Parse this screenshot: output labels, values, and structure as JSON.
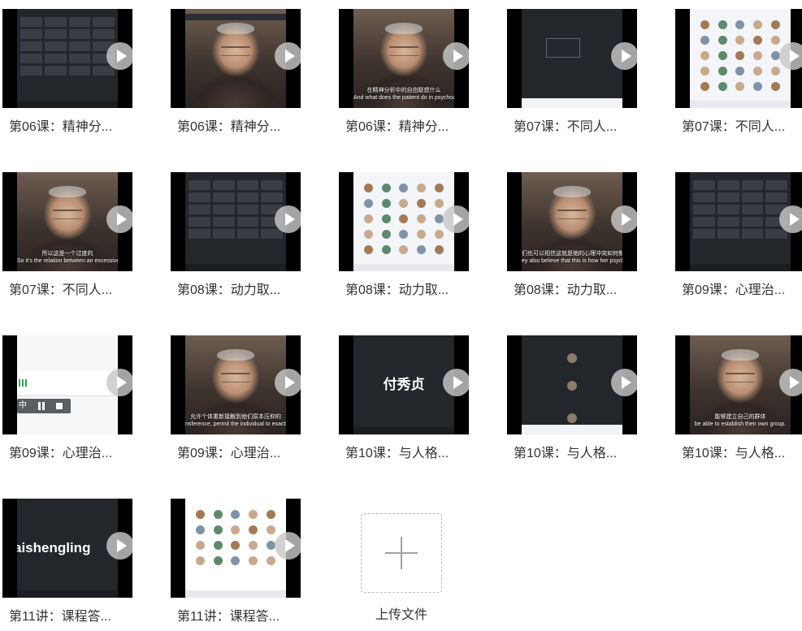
{
  "videos": [
    {
      "id": "v1",
      "caption": "第06课：精神分...",
      "style": "dark-tiles"
    },
    {
      "id": "v2",
      "caption": "第06课：精神分...",
      "style": "person-zoom"
    },
    {
      "id": "v3",
      "caption": "第06课：精神分...",
      "style": "person",
      "subtitle_cn": "在精神分析中的自由联想什么",
      "subtitle_en": "And what does the patient do in psychoanalysis"
    },
    {
      "id": "v4",
      "caption": "第07课：不同人...",
      "style": "dark-empty"
    },
    {
      "id": "v5",
      "caption": "第07课：不同人...",
      "style": "avatars"
    },
    {
      "id": "v6",
      "caption": "第07课：不同人...",
      "style": "person",
      "subtitle_cn": "所以这是一个过度的",
      "subtitle_en": "So it's the relation between an excessive,"
    },
    {
      "id": "v7",
      "caption": "第08课：动力取...",
      "style": "dark-tiles"
    },
    {
      "id": "v8",
      "caption": "第08课：动力取...",
      "style": "avatars"
    },
    {
      "id": "v9",
      "caption": "第08课：动力取...",
      "style": "person",
      "subtitle_cn": "们也可以相信这就是她的心理冲突如何影响她",
      "subtitle_en": "ey also believe that this is how her psych conflicts affect her."
    },
    {
      "id": "v10",
      "caption": "第09课：心理治...",
      "style": "dark-tiles"
    },
    {
      "id": "v11",
      "caption": "第09课：心理治...",
      "style": "screen-share",
      "pill_text": "中"
    },
    {
      "id": "v12",
      "caption": "第09课：心理治...",
      "style": "person",
      "subtitle_cn": "允许个体重新接触到他们原本压抑的",
      "subtitle_en": "nsference, permit the individual to exactly they originally repressed forbidden integrate them."
    },
    {
      "id": "v13",
      "caption": "第10课：与人格...",
      "style": "name-card",
      "name_text": "付秀贞"
    },
    {
      "id": "v14",
      "caption": "第10课：与人格...",
      "style": "dark-call"
    },
    {
      "id": "v15",
      "caption": "第10课：与人格...",
      "style": "person",
      "subtitle_cn": "能够建立自己的群体",
      "subtitle_en": "be able to establish their own group."
    },
    {
      "id": "v16",
      "caption": "第11讲：课程答...",
      "style": "name-card-left",
      "name_text": "aishengling"
    },
    {
      "id": "v17",
      "caption": "第11讲：课程答...",
      "style": "avatars-white"
    }
  ],
  "upload": {
    "label": "上传文件",
    "icon": "plus-icon"
  }
}
